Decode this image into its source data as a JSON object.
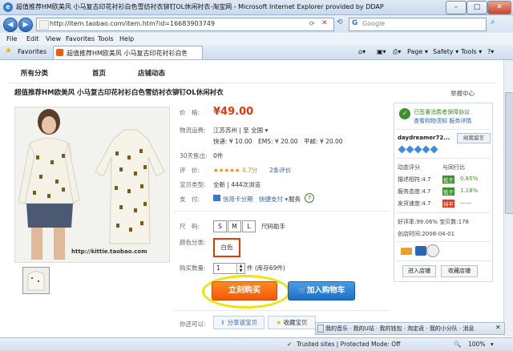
{
  "window": {
    "title": "超值推荐HM欧美风 小马复古印花衬衫白色雪纺衬衣铆钉OL休闲衬衣-淘宝网 - Microsoft Internet Explorer provided by DDAP",
    "min_label": "–",
    "max_label": "□",
    "close_label": "✕"
  },
  "addressbar": {
    "url": "http://item.taobao.com/item.htm?id=16683903749",
    "search_placeholder": "Google"
  },
  "menu": [
    "File",
    "Edit",
    "View",
    "Favorites",
    "Tools",
    "Help"
  ],
  "tabs": {
    "favorites_label": "Favorites",
    "active_tab": "超值推荐HM欧美风 小马复古印花衬衫白色雪纺..."
  },
  "commandbar": {
    "page": "Page ▾",
    "safety": "Safety ▾",
    "tools": "Tools ▾"
  },
  "shopnav": [
    "所有分类",
    "首页",
    "店铺动态"
  ],
  "product": {
    "title": "超值推荐HM欧美风 小马复古印花衬衫白色雪纺衬衣铆钉OL休闲衬衣",
    "report": "举报中心",
    "watermark": "http://kittie.taobao.com",
    "price_label": "价　格:",
    "price": "¥49.00",
    "ship_label": "物流运费:",
    "ship_from": "江苏苏州 | 至 全国 ▾",
    "ship_fees": "快递: ¥ 10.00　EMS: ¥ 20.00　平邮: ¥ 20.00",
    "sold_label": "30天售出:",
    "sold": "0件",
    "rating_label": "评　价:",
    "rating": "★★★★★ 4.7分",
    "rating_count": "2条评价",
    "card_label": "宝贝类型:",
    "card": "全新 | 444次浏览",
    "pay_label": "支　付:",
    "pay": "信用卡分期　快捷支付 ▾",
    "service": "服务",
    "size_label": "尺　码:",
    "sizes": [
      "S",
      "M",
      "L"
    ],
    "size_help": "尺码助手",
    "color_label": "颜色分类:",
    "color": "白色",
    "qty_label": "购买数量:",
    "qty": "1",
    "stock": "件 (库存69件)",
    "buy": "立刻购买",
    "cart": "加入购物车",
    "maybe_label": "你还可以:",
    "share": "分享该宝贝",
    "collect": "收藏宝贝"
  },
  "seller": {
    "protect": "已签署消费者保障协议",
    "protect_sub": "查看购物须知 服务详情",
    "name": "daydreamer72...",
    "contact": "给我留言",
    "score_head": "动态评分",
    "compare_head": "与同行比",
    "rows": [
      {
        "label": "描述相符:4.7",
        "tag": "低于",
        "pct": "0.85%"
      },
      {
        "label": "服务态度:4.7",
        "tag": "低于",
        "pct": "1.18%"
      },
      {
        "label": "发货速度:4.7",
        "tag": "持平",
        "pct": "——"
      }
    ],
    "goodrate": "好评率:99.06%  宝贝数:178",
    "created": "创店时间:2008-04-01",
    "enter": "进入店铺",
    "collect_shop": "收藏店铺"
  },
  "bottombar": "我的音乐 · 我的U站 · 我的钱包 · 淘定返 · 我的小分队 · 消息",
  "statusbar": {
    "trusted": "Trusted sites | Protected Mode: Off",
    "zoom": "100%"
  }
}
